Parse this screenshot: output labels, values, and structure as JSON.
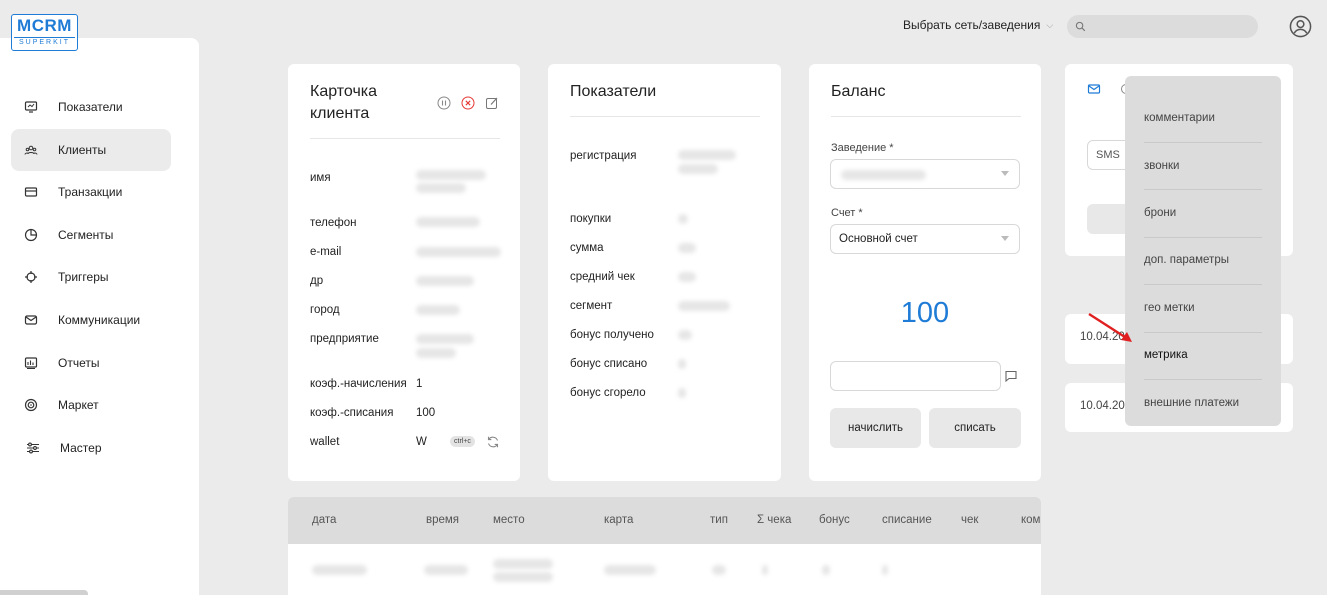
{
  "logo": {
    "main": "MCRM",
    "sub": "SUPERKIT"
  },
  "topbar": {
    "network_select": "Выбрать сеть/заведения",
    "search_placeholder": ""
  },
  "sidebar": {
    "items": [
      {
        "label": "Показатели",
        "icon": "dashboard-icon",
        "active": false
      },
      {
        "label": "Клиенты",
        "icon": "clients-icon",
        "active": true
      },
      {
        "label": "Транзакции",
        "icon": "card-icon",
        "active": false
      },
      {
        "label": "Сегменты",
        "icon": "pie-icon",
        "active": false
      },
      {
        "label": "Триггеры",
        "icon": "target-icon",
        "active": false
      },
      {
        "label": "Коммуникации",
        "icon": "mail-icon",
        "active": false
      },
      {
        "label": "Отчеты",
        "icon": "report-icon",
        "active": false
      },
      {
        "label": "Маркет",
        "icon": "market-icon",
        "active": false
      },
      {
        "label": "Мастер",
        "icon": "sliders-icon",
        "active": false
      }
    ]
  },
  "client_card": {
    "title_line1": "Карточка",
    "title_line2": "клиента",
    "fields": [
      {
        "label": "имя"
      },
      {
        "label": "телефон"
      },
      {
        "label": "e-mail"
      },
      {
        "label": "др"
      },
      {
        "label": "город"
      },
      {
        "label": "предприятие"
      },
      {
        "label": "коэф.-начисления",
        "value": "1"
      },
      {
        "label": "коэф.-списания",
        "value": "100"
      },
      {
        "label": "wallet",
        "value": "W",
        "badge": "ctrl+c"
      }
    ]
  },
  "metrics_card": {
    "title": "Показатели",
    "fields": [
      {
        "label": "регистрация"
      },
      {
        "label": "покупки"
      },
      {
        "label": "сумма"
      },
      {
        "label": "средний чек"
      },
      {
        "label": "сегмент"
      },
      {
        "label": "бонус получено"
      },
      {
        "label": "бонус списано"
      },
      {
        "label": "бонус сгорело"
      }
    ]
  },
  "balance_card": {
    "title": "Баланс",
    "venue_label": "Заведение *",
    "account_label": "Счет *",
    "account_value": "Основной счет",
    "balance": "100",
    "accrue_button": "начислить",
    "writeoff_button": "списать"
  },
  "comm_card": {
    "sms_label": "SMS"
  },
  "dates": [
    "10.04.20",
    "10.04.20"
  ],
  "dropdown": {
    "items": [
      "комментарии",
      "звонки",
      "брони",
      "доп. параметры",
      "гео метки",
      "метрика",
      "внешние платежи"
    ],
    "highlighted": "метрика"
  },
  "table": {
    "headers": [
      "дата",
      "время",
      "место",
      "карта",
      "тип",
      "Σ чека",
      "бонус",
      "списание",
      "чек",
      "ком"
    ]
  },
  "colors": {
    "accent": "#1e7bd6",
    "arrow": "#e02020"
  }
}
